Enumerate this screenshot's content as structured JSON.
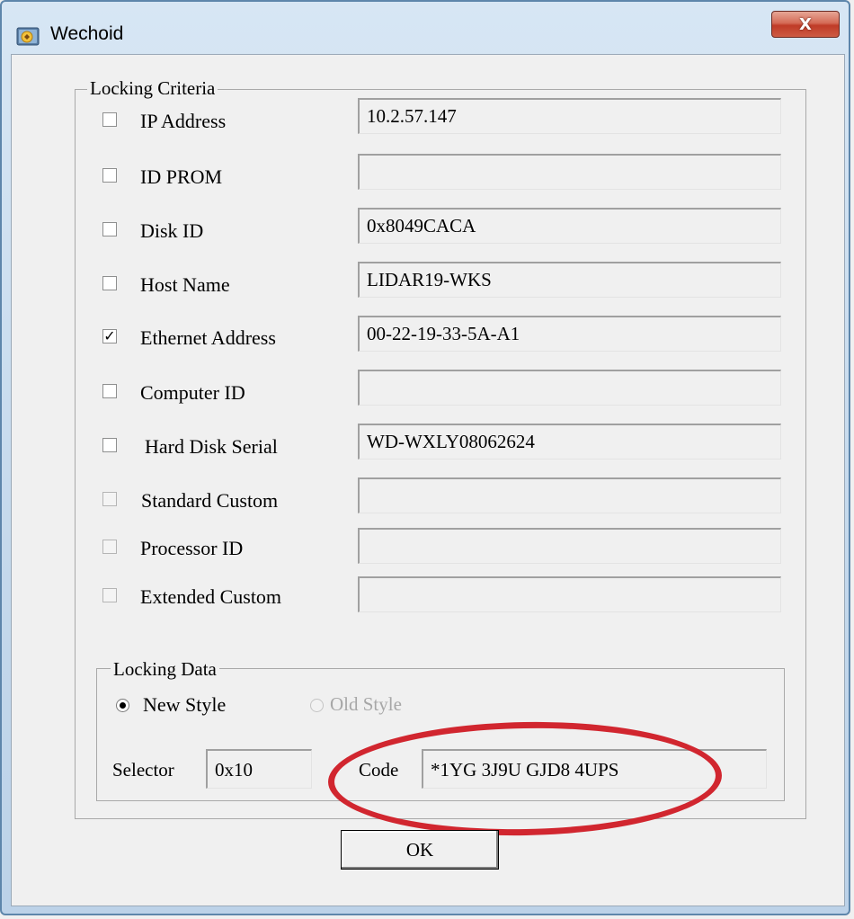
{
  "window": {
    "title": "Wechoid",
    "close_label": "X"
  },
  "locking_criteria": {
    "legend": "Locking Criteria",
    "rows": [
      {
        "label": "IP Address",
        "checked": false,
        "value": "10.2.57.147"
      },
      {
        "label": "ID PROM",
        "checked": false,
        "value": ""
      },
      {
        "label": "Disk ID",
        "checked": false,
        "value": "0x8049CACA"
      },
      {
        "label": "Host Name",
        "checked": false,
        "value": "LIDAR19-WKS"
      },
      {
        "label": "Ethernet Address",
        "checked": true,
        "value": "00-22-19-33-5A-A1"
      },
      {
        "label": "Computer ID",
        "checked": false,
        "value": ""
      },
      {
        "label": "Hard Disk Serial",
        "checked": false,
        "value": "WD-WXLY08062624"
      },
      {
        "label": "Standard Custom",
        "checked": false,
        "value": ""
      },
      {
        "label": "Processor ID",
        "checked": false,
        "value": ""
      },
      {
        "label": "Extended Custom",
        "checked": false,
        "value": ""
      }
    ]
  },
  "locking_data": {
    "legend": "Locking Data",
    "new_style_label": "New Style",
    "old_style_label": "Old Style",
    "selected_style": "New Style",
    "selector_label": "Selector",
    "selector_value": "0x10",
    "code_label": "Code",
    "code_value": "*1YG 3J9U GJD8 4UPS"
  },
  "ok_label": "OK",
  "colors": {
    "annotation": "#d1262f",
    "title_bar": "#c5d9ec",
    "close_button": "#c9462f"
  }
}
